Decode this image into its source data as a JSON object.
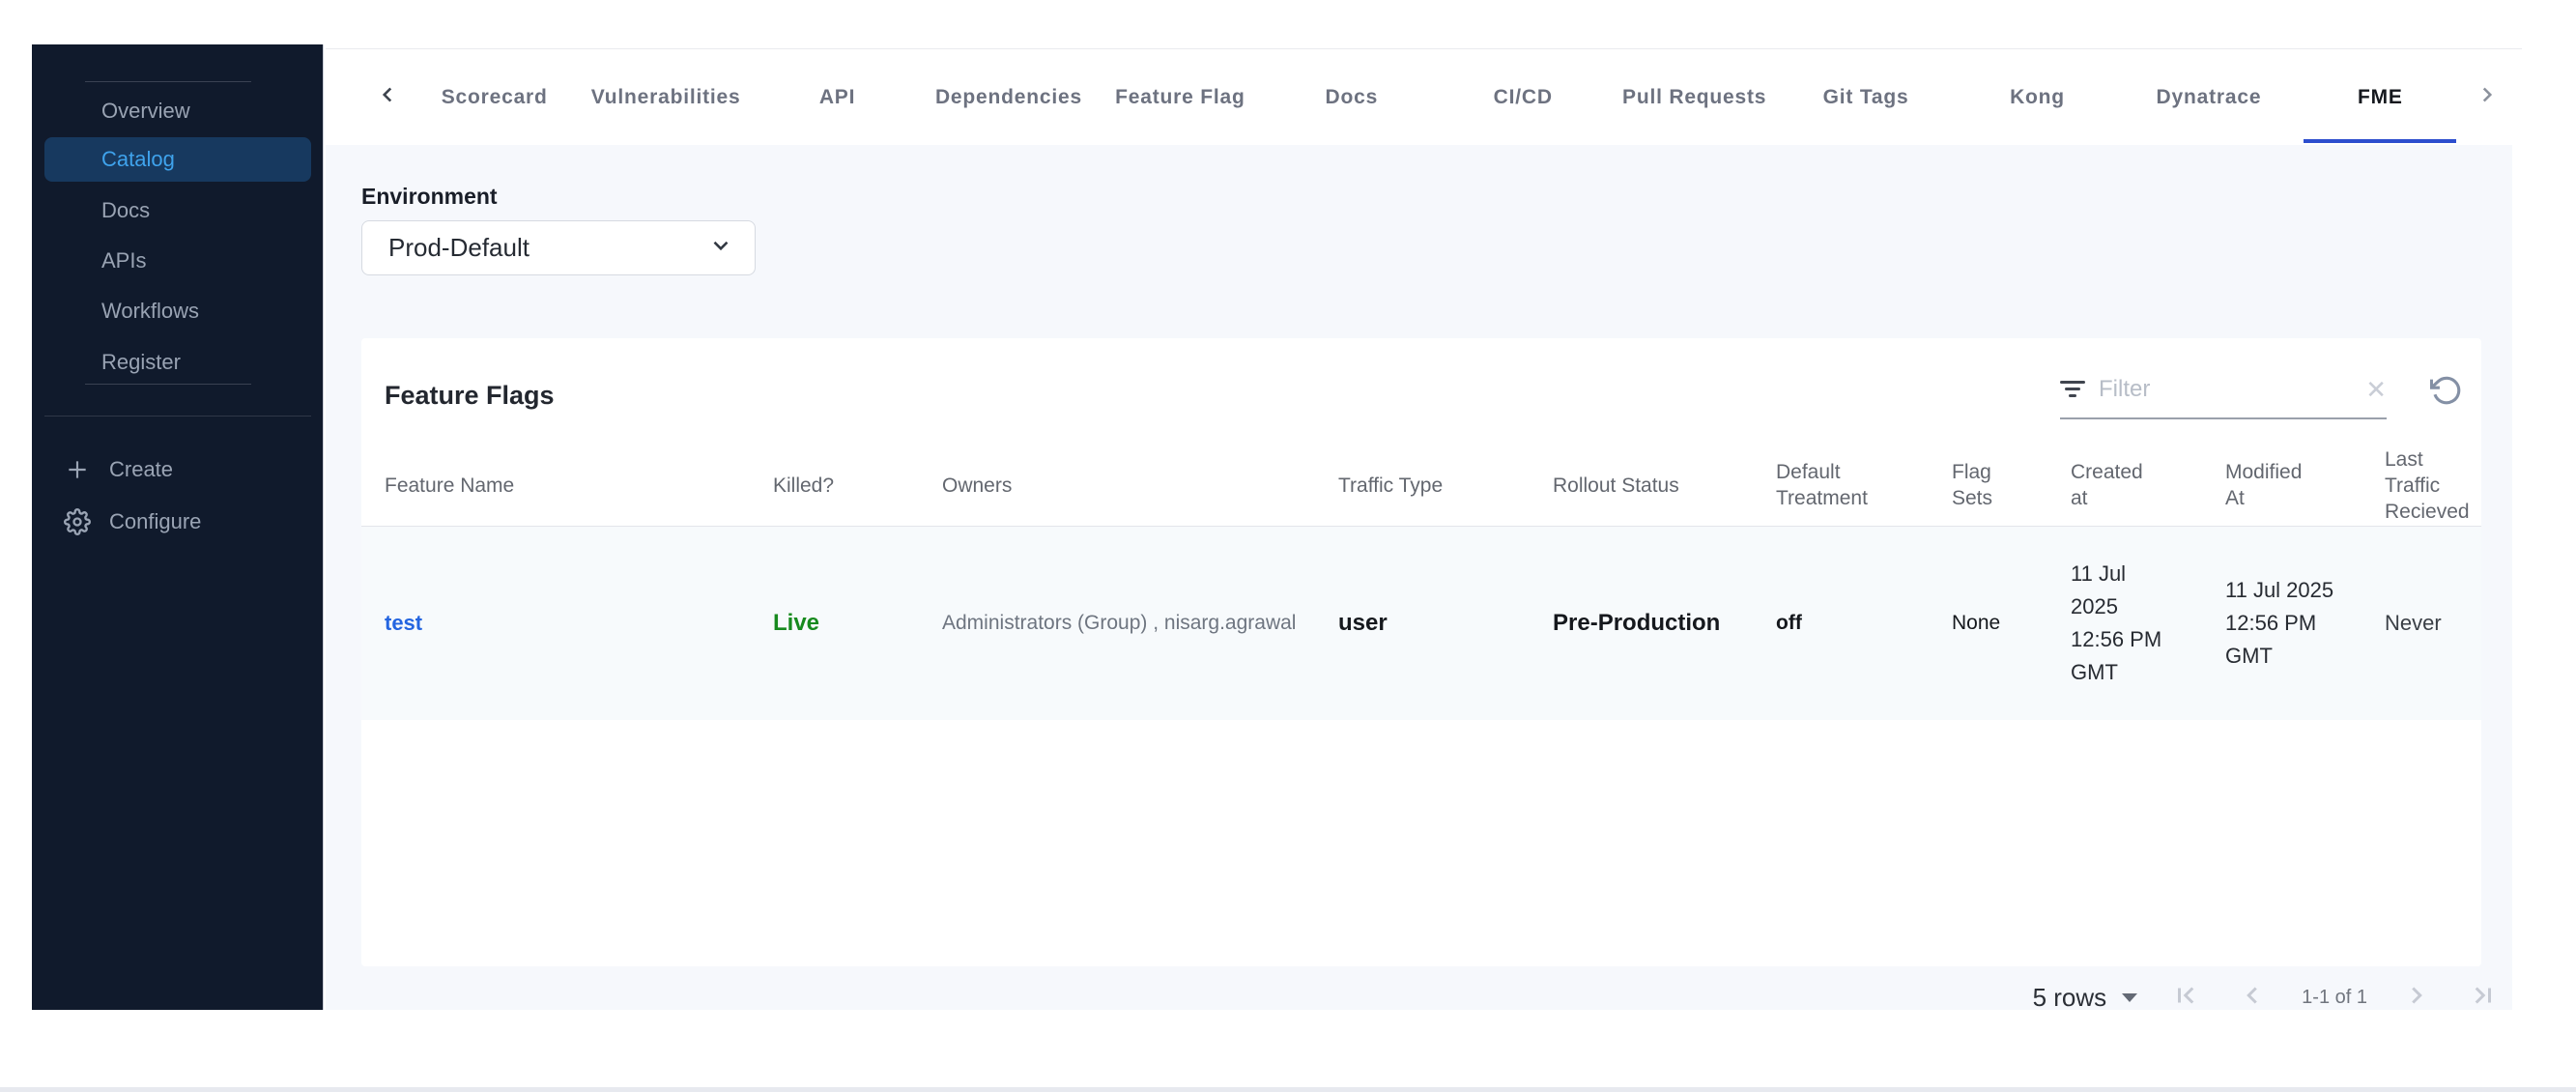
{
  "sidebar": {
    "items": [
      "Overview",
      "Catalog",
      "Docs",
      "APIs",
      "Workflows",
      "Register"
    ],
    "active_item": "Catalog",
    "create_label": "Create",
    "configure_label": "Configure"
  },
  "tabs": {
    "items": [
      "Scorecard",
      "Vulnerabilities",
      "API",
      "Dependencies",
      "Feature Flag",
      "Docs",
      "CI/CD",
      "Pull Requests",
      "Git Tags",
      "Kong",
      "Dynatrace",
      "FME"
    ],
    "active": "FME"
  },
  "environment": {
    "label": "Environment",
    "selected": "Prod-Default"
  },
  "feature_flags": {
    "title": "Feature Flags",
    "filter_placeholder": "Filter",
    "columns": [
      "Feature Name",
      "Killed?",
      "Owners",
      "Traffic Type",
      "Rollout Status",
      "Default Treatment",
      "Flag Sets",
      "Created at",
      "Modified At",
      "Last Traffic Recieved"
    ],
    "rows": [
      {
        "feature_name": "test",
        "killed": "Live",
        "owners": "Administrators (Group) , nisarg.agrawal",
        "traffic_type": "user",
        "rollout_status": "Pre-Production",
        "default_treatment": "off",
        "flag_sets": "None",
        "created_at": "11 Jul\n2025\n12:56 PM\nGMT",
        "modified_at": "11 Jul 2025\n12:56 PM\nGMT",
        "last_traffic_received": "Never"
      }
    ],
    "pagination": {
      "rows_per_page": "5 rows",
      "range": "1-1 of 1"
    }
  },
  "colors": {
    "accent_blue": "#2d4ece",
    "link_blue": "#2465e0",
    "live_green": "#178a1e",
    "sidebar_bg": "#101a2c",
    "active_item_bg": "#17395f",
    "active_item_text": "#3fa3ec",
    "content_bg": "#f6f8fc"
  }
}
